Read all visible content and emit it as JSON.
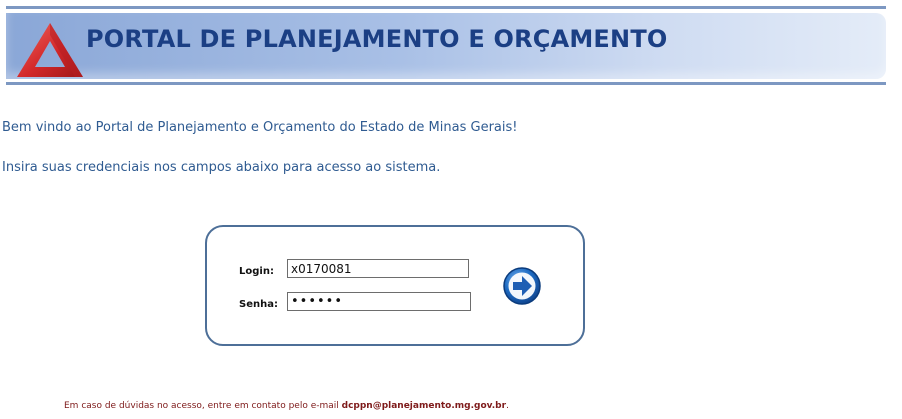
{
  "header": {
    "title": "PORTAL DE PLANEJAMENTO  E ORÇAMENTO",
    "logo": "triangle-logo"
  },
  "intro": {
    "welcome": "Bem vindo ao Portal de Planejamento e Orçamento do Estado de Minas Gerais!",
    "instructions": "Insira suas credenciais nos campos abaixo para acesso ao sistema."
  },
  "login_form": {
    "login_label": "Login:",
    "login_value": "x0170081",
    "password_label": "Senha:",
    "password_value": "••••••",
    "submit_icon": "arrow-right-icon"
  },
  "footer": {
    "text": "Em caso de dúvidas no acesso, entre em contato pelo e-mail ",
    "email": "dcppn@planejamento.mg.gov.br",
    "trailing": "."
  },
  "colors": {
    "banner_start": "#8aa7d7",
    "title": "#1b3f84",
    "text": "#2f5b91",
    "box_border": "#4d6f98",
    "logo_red": "#d2282a",
    "button_blue": "#1f6cc3",
    "footer": "#7e1a1a"
  }
}
